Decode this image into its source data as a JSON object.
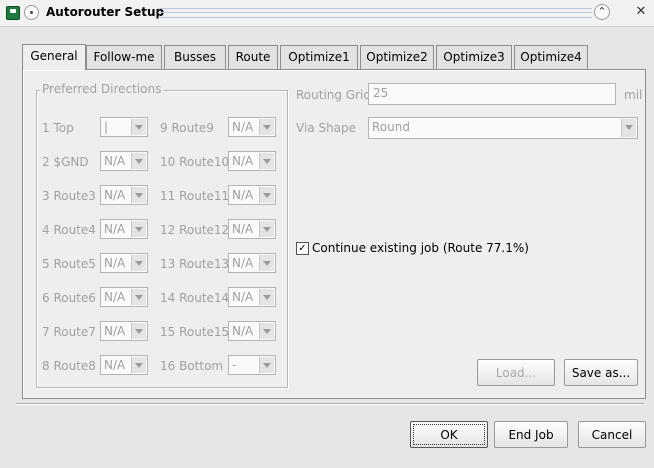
{
  "window": {
    "title": "Autorouter Setup"
  },
  "tabs": [
    {
      "label": "General",
      "active": true
    },
    {
      "label": "Follow-me"
    },
    {
      "label": "Busses"
    },
    {
      "label": "Route"
    },
    {
      "label": "Optimize1"
    },
    {
      "label": "Optimize2"
    },
    {
      "label": "Optimize3"
    },
    {
      "label": "Optimize4"
    }
  ],
  "preferred_directions": {
    "title": "Preferred Directions",
    "left": [
      {
        "label": "1 Top",
        "value": "|"
      },
      {
        "label": "2 $GND",
        "value": "N/A"
      },
      {
        "label": "3 Route3",
        "value": "N/A"
      },
      {
        "label": "4 Route4",
        "value": "N/A"
      },
      {
        "label": "5 Route5",
        "value": "N/A"
      },
      {
        "label": "6 Route6",
        "value": "N/A"
      },
      {
        "label": "7 Route7",
        "value": "N/A"
      },
      {
        "label": "8 Route8",
        "value": "N/A"
      }
    ],
    "right": [
      {
        "label": "9 Route9",
        "value": "N/A"
      },
      {
        "label": "10 Route10",
        "value": "N/A"
      },
      {
        "label": "11 Route11",
        "value": "N/A"
      },
      {
        "label": "12 Route12",
        "value": "N/A"
      },
      {
        "label": "13 Route13",
        "value": "N/A"
      },
      {
        "label": "14 Route14",
        "value": "N/A"
      },
      {
        "label": "15 Route15",
        "value": "N/A"
      },
      {
        "label": "16 Bottom",
        "value": "-"
      }
    ]
  },
  "routing_grid": {
    "label": "Routing Grid",
    "value": "25",
    "unit": "mil"
  },
  "via_shape": {
    "label": "Via Shape",
    "value": "Round"
  },
  "continue_job": {
    "label": "Continue existing job (Route 77.1%)",
    "checked": true,
    "mark": "✓"
  },
  "buttons": {
    "load": "Load...",
    "save_as": "Save as...",
    "ok": "OK",
    "end_job": "End Job",
    "cancel": "Cancel"
  },
  "titlebar": {
    "up_glyph": "⌃",
    "close_glyph": "✕"
  }
}
